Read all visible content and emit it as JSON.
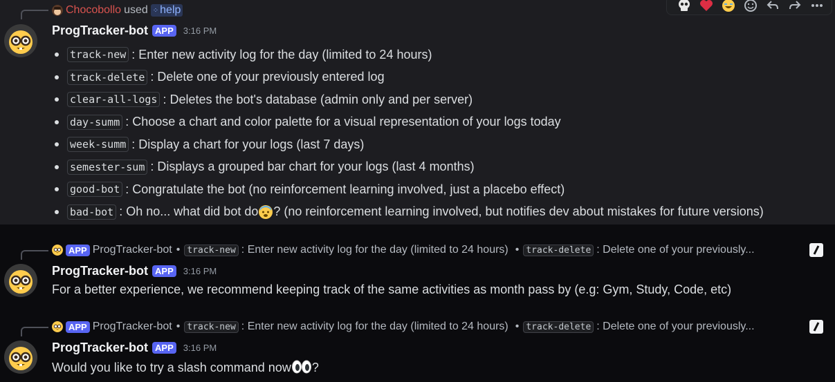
{
  "message1": {
    "invoker": "Chocobollo",
    "used_text": "used",
    "command": "help",
    "bot_name": "ProgTracker-bot",
    "app_badge": "APP",
    "time": "3:16 PM",
    "items": [
      {
        "cmd": "track-new",
        "desc": ": Enter new activity log for the day (limited to 24 hours)"
      },
      {
        "cmd": "track-delete",
        "desc": ": Delete one of your previously entered log"
      },
      {
        "cmd": "clear-all-logs",
        "desc": ": Deletes the bot's database (admin only and per server)"
      },
      {
        "cmd": "day-summ",
        "desc": ": Choose a chart and color palette for a visual representation of your logs today"
      },
      {
        "cmd": "week-summ",
        "desc": ": Display a chart for your logs (last 7 days)"
      },
      {
        "cmd": "semester-sum",
        "desc": ": Displays a grouped bar chart for your logs (last 4 months)"
      },
      {
        "cmd": "good-bot",
        "desc": ": Congratulate the bot (no reinforcement learning involved, just a placebo effect)"
      },
      {
        "cmd": "bad-bot",
        "desc_before": ": Oh no... what did bot do",
        "desc_after": "? (no reinforcement learning involved, but notifies dev about mistakes for future versions)"
      }
    ],
    "toolbar_icons": [
      "skull-icon",
      "heart-icon",
      "joy-icon",
      "add-reaction-icon",
      "reply-icon",
      "forward-icon",
      "more-icon"
    ]
  },
  "message2": {
    "reply": {
      "app_badge": "APP",
      "bot_name": "ProgTracker-bot",
      "bullet": "•",
      "cmd1": "track-new",
      "desc1": ": Enter new activity log for the day (limited to 24 hours)",
      "cmd2": "track-delete",
      "desc2": ": Delete one of your previously..."
    },
    "bot_name": "ProgTracker-bot",
    "app_badge": "APP",
    "time": "3:16 PM",
    "text": "For a better experience, we recommend keeping track of the same activities as month pass by (e.g: Gym, Study, Code, etc)"
  },
  "message3": {
    "reply": {
      "app_badge": "APP",
      "bot_name": "ProgTracker-bot",
      "bullet": "•",
      "cmd1": "track-new",
      "desc1": ": Enter new activity log for the day (limited to 24 hours)",
      "cmd2": "track-delete",
      "desc2": ": Delete one of your previously..."
    },
    "bot_name": "ProgTracker-bot",
    "app_badge": "APP",
    "time": "3:16 PM",
    "text_before": "Would you like to try a slash command now",
    "text_after": "?"
  },
  "colors": {
    "background": "#0b0b0e",
    "hover_background": "#1d1d21",
    "app_badge": "#5865f2",
    "invoker_name": "#d9534f",
    "slash_command": "#8fb3ff"
  }
}
